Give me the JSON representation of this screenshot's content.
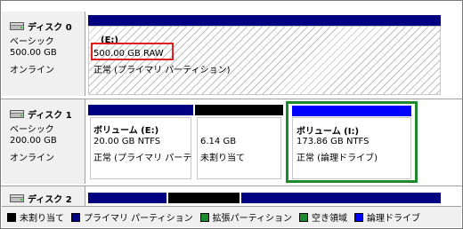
{
  "colors": {
    "primary": "#000080",
    "unallocated": "#000000",
    "extended": "#1e8a2e",
    "free": "#1e8a2e",
    "logical": "#0000ff",
    "highlight_red": "#e02020",
    "highlight_green": "#1e8a2e"
  },
  "disks": [
    {
      "name": "ディスク 0",
      "type": "ベーシック",
      "size": "500.00 GB",
      "status": "オンライン",
      "partitions": [
        {
          "label": "(E:)",
          "size": "500.00 GB RAW",
          "state": "正常 (プライマリ パーティション)"
        }
      ]
    },
    {
      "name": "ディスク 1",
      "type": "ベーシック",
      "size": "200.00 GB",
      "status": "オンライン",
      "partitions": [
        {
          "label": "ボリューム (E:)",
          "size": "20.00 GB NTFS",
          "state": "正常 (プライマリ パーテ"
        },
        {
          "label": "",
          "size": "6.14 GB",
          "state": "未割り当て"
        },
        {
          "label": "ボリューム (I:)",
          "size": "173.86 GB NTFS",
          "state": "正常 (論理ドライブ)"
        }
      ]
    },
    {
      "name": "ディスク 2"
    }
  ],
  "legend": [
    {
      "label": "未割り当て",
      "color": "#000000"
    },
    {
      "label": "プライマリ パーティション",
      "color": "#000080"
    },
    {
      "label": "拡張パーティション",
      "color": "#1e8a2e"
    },
    {
      "label": "空き領域",
      "color": "#1e8a2e"
    },
    {
      "label": "論理ドライブ",
      "color": "#0000ff"
    }
  ]
}
